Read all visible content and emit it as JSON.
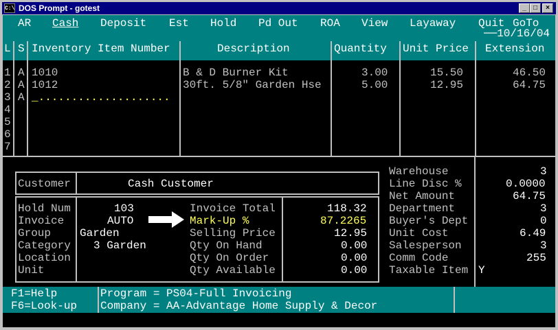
{
  "window": {
    "title": "DOS Prompt - gotest",
    "icon": "C:\\",
    "minimize": "_",
    "maximize": "□",
    "close": "×"
  },
  "menu": {
    "items": [
      "AR",
      "Cash",
      "Deposit",
      "Est",
      "Hold",
      "Pd Out",
      "ROA",
      "View",
      "Layaway",
      "Quit",
      "GoTo"
    ],
    "selected": "Cash",
    "date": "10/16/04"
  },
  "grid": {
    "headers": {
      "line": "L",
      "status": "S",
      "item": "Inventory Item Number",
      "desc": "Description",
      "qty": "Quantity",
      "price": "Unit Price",
      "ext": "Extension"
    },
    "row_numbers": [
      "1",
      "2",
      "3",
      "4",
      "5",
      "6",
      "7"
    ],
    "rows": [
      {
        "s": "A",
        "item": "1010",
        "desc": "B & D Burner Kit",
        "qty": "3.00",
        "price": "15.50",
        "ext": "46.50"
      },
      {
        "s": "A",
        "item": "1012",
        "desc": "30ft. 5/8\" Garden Hse",
        "qty": "5.00",
        "price": "12.95",
        "ext": "64.75"
      },
      {
        "s": "A",
        "item": "_....................",
        "desc": "",
        "qty": "",
        "price": "",
        "ext": ""
      }
    ]
  },
  "customer": {
    "label": "Customer",
    "value": "Cash Customer"
  },
  "info": {
    "hold_num": {
      "label": "Hold Num",
      "value": "103"
    },
    "invoice": {
      "label": "Invoice",
      "value": "AUTO"
    },
    "group": {
      "label": "Group",
      "value": "Garden"
    },
    "category": {
      "label": "Category",
      "value": "3 Garden"
    },
    "location": {
      "label": "Location",
      "value": ""
    },
    "unit": {
      "label": "Unit",
      "value": ""
    }
  },
  "totals": {
    "invoice_total": {
      "label": "Invoice Total",
      "value": "118.32"
    },
    "markup": {
      "label": "Mark-Up %",
      "value": "87.2265"
    },
    "selling_price": {
      "label": "Selling Price",
      "value": "12.95"
    },
    "qty_on_hand": {
      "label": "Qty On Hand",
      "value": "0.00"
    },
    "qty_on_order": {
      "label": "Qty On Order",
      "value": "0.00"
    },
    "qty_available": {
      "label": "Qty Available",
      "value": "0.00"
    }
  },
  "details": {
    "warehouse": {
      "label": "Warehouse",
      "value": "3"
    },
    "line_disc": {
      "label": "Line Disc %",
      "value": "0.0000"
    },
    "net_amount": {
      "label": "Net Amount",
      "value": "64.75"
    },
    "department": {
      "label": "Department",
      "value": "3"
    },
    "buyers_dept": {
      "label": "Buyer's Dept",
      "value": "0"
    },
    "unit_cost": {
      "label": "Unit Cost",
      "value": "6.49"
    },
    "salesperson": {
      "label": "Salesperson",
      "value": "3"
    },
    "comm_code": {
      "label": "Comm Code",
      "value": "255"
    },
    "taxable_item": {
      "label": "Taxable Item",
      "value": "Y"
    }
  },
  "footer": {
    "f1": "F1=Help",
    "f6": "F6=Look-up",
    "program": "Program = PS04-Full Invoicing",
    "company": "Company = AA-Advantage Home Supply & Decor"
  }
}
